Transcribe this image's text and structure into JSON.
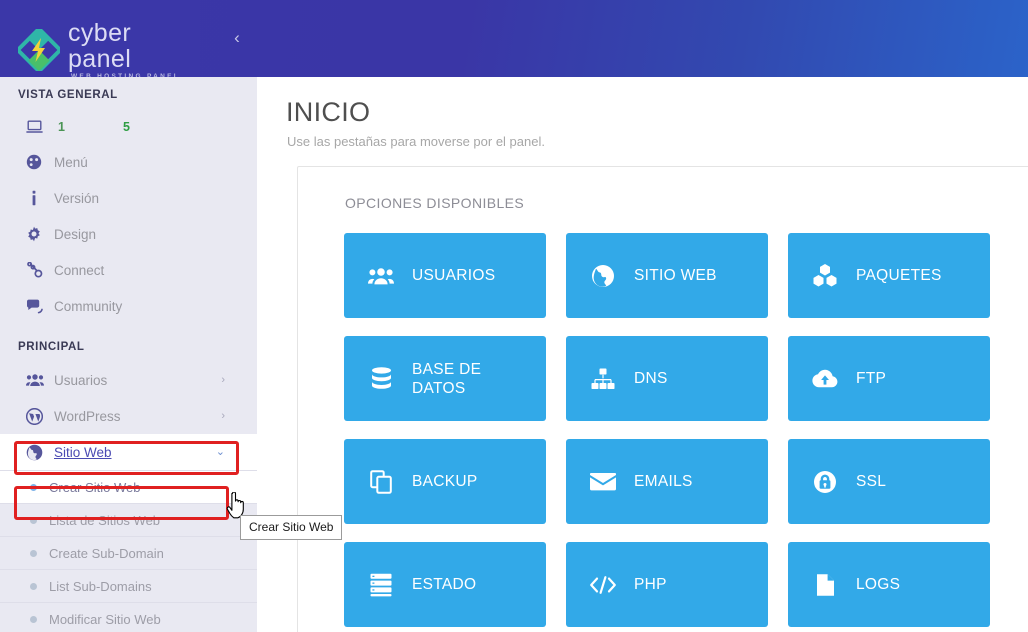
{
  "brand": {
    "name": "cyber panel",
    "tagline": "WEB HOSTING PANEL",
    "logo_icon": "diamond-bolt-logo",
    "collapse_icon": "chevron-left-icon"
  },
  "sidebar": {
    "section_overview_title": "VISTA GENERAL",
    "section_main_title": "PRINCIPAL",
    "stats": {
      "icon": "laptop-icon",
      "value_a": "1",
      "value_b": "5"
    },
    "overview_items": [
      {
        "label": "Menú",
        "icon": "dashboard-icon"
      },
      {
        "label": "Versión",
        "icon": "info-icon"
      },
      {
        "label": "Design",
        "icon": "gear-icon"
      },
      {
        "label": "Connect",
        "icon": "link-icon"
      },
      {
        "label": "Community",
        "icon": "comments-icon"
      }
    ],
    "main_items": [
      {
        "label": "Usuarios",
        "icon": "users-icon",
        "chevron": "›"
      },
      {
        "label": "WordPress",
        "icon": "wordpress-icon",
        "chevron": "›"
      },
      {
        "label": "Sitio Web",
        "icon": "globe-icon",
        "chevron": "⌄"
      }
    ],
    "submenu_items": [
      {
        "label": "Crear Sitio Web"
      },
      {
        "label": "Lista de Sitios Web"
      },
      {
        "label": "Create Sub-Domain"
      },
      {
        "label": "List Sub-Domains"
      },
      {
        "label": "Modificar Sitio Web"
      }
    ]
  },
  "tooltip": {
    "text": "Crear Sitio Web"
  },
  "main": {
    "title": "INICIO",
    "subtitle": "Use las pestañas para moverse por el panel.",
    "card_heading": "OPCIONES DISPONIBLES",
    "tiles": [
      {
        "label": "USUARIOS",
        "icon": "users-icon"
      },
      {
        "label": "SITIO WEB",
        "icon": "globe-icon"
      },
      {
        "label": "PAQUETES",
        "icon": "cubes-icon"
      },
      {
        "label": "BASE DE DATOS",
        "icon": "database-icon"
      },
      {
        "label": "DNS",
        "icon": "sitemap-icon"
      },
      {
        "label": "FTP",
        "icon": "cloud-upload-icon"
      },
      {
        "label": "BACKUP",
        "icon": "copy-icon"
      },
      {
        "label": "EMAILS",
        "icon": "envelope-icon"
      },
      {
        "label": "SSL",
        "icon": "lock-shield-icon"
      },
      {
        "label": "ESTADO",
        "icon": "server-icon"
      },
      {
        "label": "PHP",
        "icon": "code-icon"
      },
      {
        "label": "LOGS",
        "icon": "file-icon"
      }
    ]
  },
  "colors": {
    "topbar_start": "#3b37a8",
    "topbar_end": "#2b63c9",
    "sidebar_bg": "#e9e9f2",
    "tile_blue": "#32a9e8",
    "annotation_red": "#e02020",
    "link_purple": "#4a4ab3",
    "stat_green": "#2f9e44"
  }
}
